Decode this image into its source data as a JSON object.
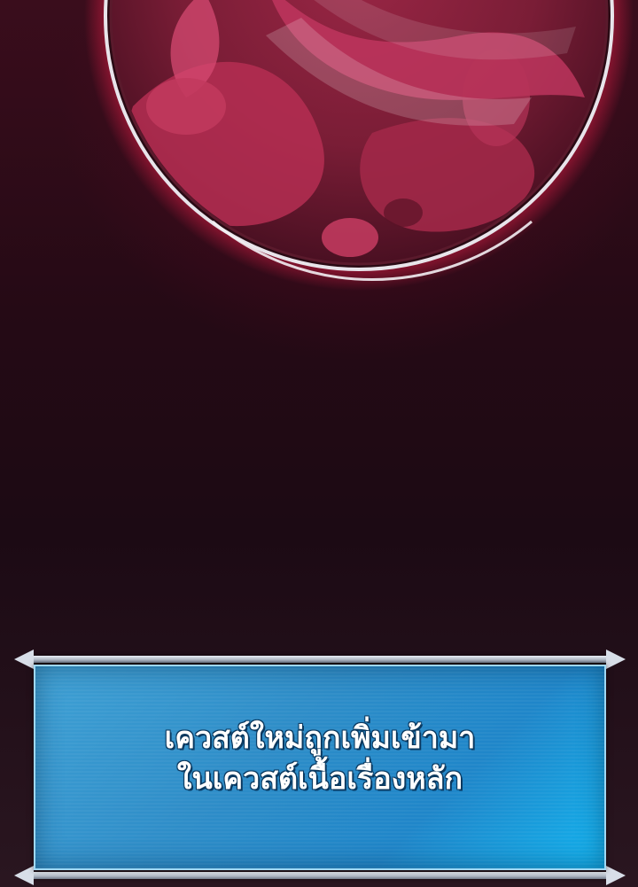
{
  "scene": {
    "orb_color": "#8c1a3a",
    "background_color": "#1c0a14"
  },
  "quest_notification": {
    "line1": "เควสต์ใหม่ถูกเพิ่มเข้ามา",
    "line2": "ในเควสต์เนื้อเรื่องหลัก",
    "panel_color": "#2e8dc8",
    "frame_color": "#d8dee8"
  }
}
